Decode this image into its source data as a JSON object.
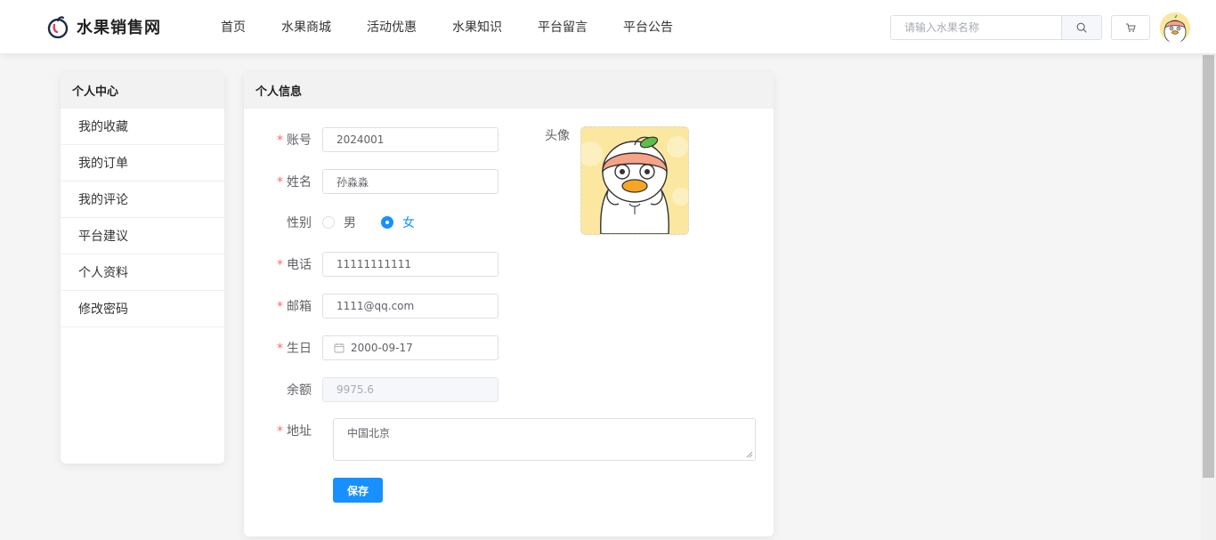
{
  "header": {
    "brand": "水果销售网",
    "nav": [
      {
        "label": "首页"
      },
      {
        "label": "水果商城"
      },
      {
        "label": "活动优惠"
      },
      {
        "label": "水果知识"
      },
      {
        "label": "平台留言"
      },
      {
        "label": "平台公告"
      }
    ],
    "search_placeholder": "请输入水果名称"
  },
  "sidebar": {
    "title": "个人中心",
    "items": [
      {
        "label": "我的收藏"
      },
      {
        "label": "我的订单"
      },
      {
        "label": "我的评论"
      },
      {
        "label": "平台建议"
      },
      {
        "label": "个人资料"
      },
      {
        "label": "修改密码"
      }
    ]
  },
  "profile": {
    "title": "个人信息",
    "fields": {
      "account": {
        "label": "账号",
        "value": "2024001",
        "required": "*"
      },
      "name": {
        "label": "姓名",
        "value": "孙淼淼",
        "required": "*"
      },
      "gender": {
        "label": "性别",
        "options": [
          "男",
          "女"
        ],
        "selected": "女"
      },
      "phone": {
        "label": "电话",
        "value": "11111111111",
        "required": "*"
      },
      "email": {
        "label": "邮箱",
        "value": "1111@qq.com",
        "required": "*"
      },
      "birthday": {
        "label": "生日",
        "value": "2000-09-17",
        "required": "*"
      },
      "balance": {
        "label": "余额",
        "value": "9975.6"
      },
      "address": {
        "label": "地址",
        "value": "中国北京",
        "required": "*"
      }
    },
    "avatar_label": "头像",
    "save_label": "保存"
  },
  "colors": {
    "primary": "#1890ff",
    "required": "#f56c6c",
    "avatar_bg": "#fbe7a0"
  }
}
